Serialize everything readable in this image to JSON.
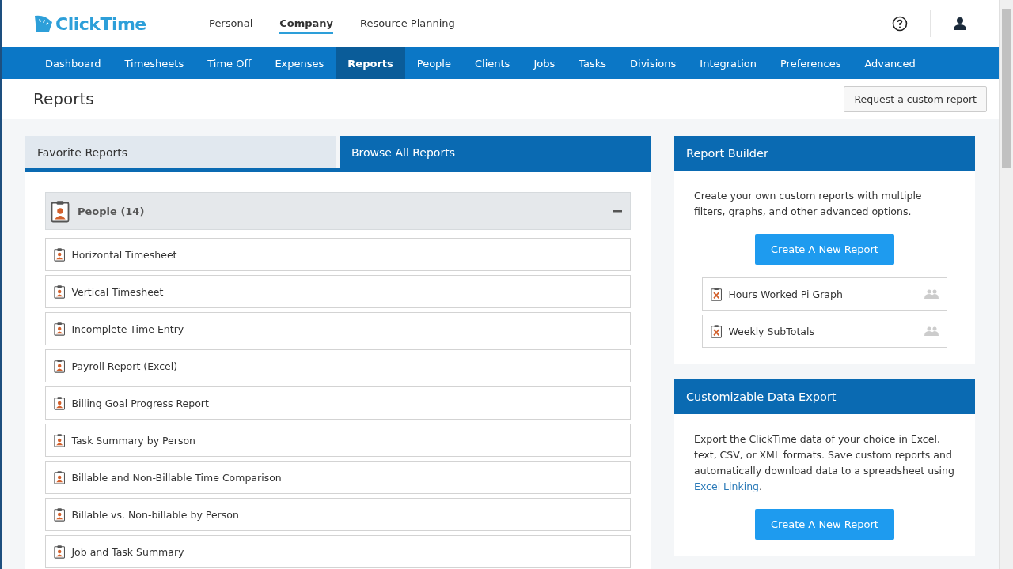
{
  "brand": {
    "name": "ClickTime"
  },
  "top_nav": [
    {
      "label": "Personal",
      "selected": false
    },
    {
      "label": "Company",
      "selected": true
    },
    {
      "label": "Resource Planning",
      "selected": false
    }
  ],
  "main_nav": [
    {
      "label": "Dashboard",
      "selected": false
    },
    {
      "label": "Timesheets",
      "selected": false
    },
    {
      "label": "Time Off",
      "selected": false
    },
    {
      "label": "Expenses",
      "selected": false
    },
    {
      "label": "Reports",
      "selected": true
    },
    {
      "label": "People",
      "selected": false
    },
    {
      "label": "Clients",
      "selected": false
    },
    {
      "label": "Jobs",
      "selected": false
    },
    {
      "label": "Tasks",
      "selected": false
    },
    {
      "label": "Divisions",
      "selected": false
    },
    {
      "label": "Integration",
      "selected": false
    },
    {
      "label": "Preferences",
      "selected": false
    },
    {
      "label": "Advanced",
      "selected": false
    }
  ],
  "page_title": "Reports",
  "request_button": "Request a custom report",
  "report_tabs": [
    {
      "label": "Favorite Reports",
      "selected": false
    },
    {
      "label": "Browse All Reports",
      "selected": true
    }
  ],
  "group": {
    "title": "People (14)",
    "expanded": true,
    "items": [
      "Horizontal Timesheet",
      "Vertical Timesheet",
      "Incomplete Time Entry",
      "Payroll Report (Excel)",
      "Billing Goal Progress Report",
      "Task Summary by Person",
      "Billable and Non-Billable Time Comparison",
      "Billable vs. Non-billable by Person",
      "Job and Task Summary"
    ]
  },
  "report_builder": {
    "title": "Report Builder",
    "description": "Create your own custom reports with multiple filters, graphs, and other advanced options.",
    "button": "Create A New Report",
    "saved_reports": [
      "Hours Worked Pi Graph",
      "Weekly SubTotals"
    ]
  },
  "data_export": {
    "title": "Customizable Data Export",
    "text_before": "Export the ClickTime data of your choice in Excel, text, CSV, or XML formats. Save custom reports and automatically download data to a spreadsheet using ",
    "link": "Excel Linking",
    "text_after": ".",
    "button": "Create A New Report"
  }
}
